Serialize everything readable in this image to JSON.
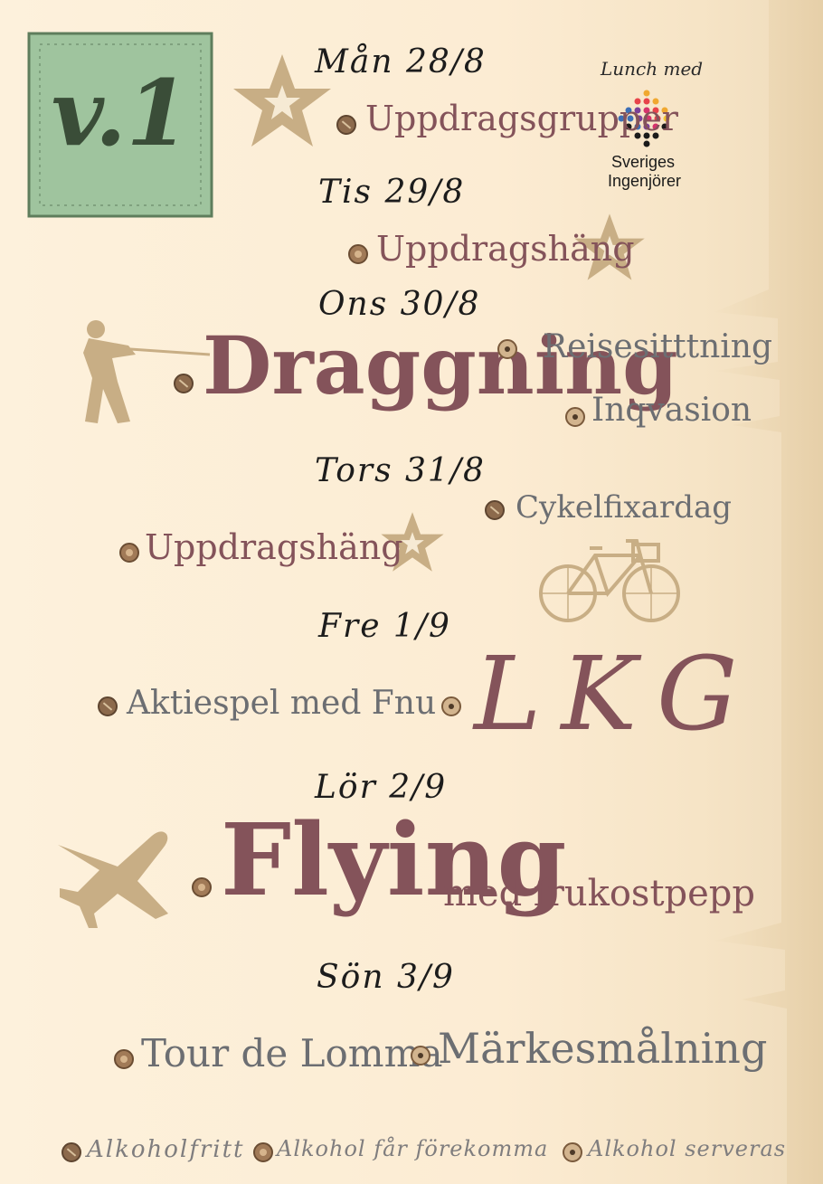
{
  "badge": {
    "text": "v.1"
  },
  "lunch": {
    "heading": "Lunch med",
    "org_line1": "Sveriges",
    "org_line2": "Ingenjörer"
  },
  "days": [
    {
      "label": "Mån 28/8",
      "events": [
        {
          "name": "Uppdragsgrupper",
          "alcohol": "free"
        }
      ]
    },
    {
      "label": "Tis 29/8",
      "events": [
        {
          "name": "Uppdragshäng",
          "alcohol": "may"
        }
      ]
    },
    {
      "label": "Ons 30/8",
      "events": [
        {
          "name": "Draggning",
          "alcohol": "free"
        },
        {
          "name": "Reisesitttning",
          "alcohol": "serve"
        },
        {
          "name": "Inqvasion",
          "alcohol": "serve"
        }
      ]
    },
    {
      "label": "Tors 31/8",
      "events": [
        {
          "name": "Uppdragshäng",
          "alcohol": "may"
        },
        {
          "name": "Cykelfixardag",
          "alcohol": "free"
        }
      ]
    },
    {
      "label": "Fre 1/9",
      "events": [
        {
          "name": "Aktiespel med Fnu",
          "alcohol": "free"
        },
        {
          "name": "LKG",
          "alcohol": "serve"
        }
      ]
    },
    {
      "label": "Lör 2/9",
      "events": [
        {
          "name": "Flying",
          "suffix": "med frukostpepp",
          "alcohol": "may"
        }
      ]
    },
    {
      "label": "Sön 3/9",
      "events": [
        {
          "name": "Tour de Lomma",
          "alcohol": "may"
        },
        {
          "name": "Märkesmålning",
          "alcohol": "serve"
        }
      ]
    }
  ],
  "legend": {
    "free": "Alkoholfritt",
    "may": "Alkohol får förekomma",
    "serve": "Alkohol serveras"
  },
  "colors": {
    "maroon": "#84535a",
    "grey": "#6c6e72",
    "tan": "#c8ae85",
    "badge_green": "#9fc49e"
  },
  "icons": [
    "star-icon",
    "tug-of-war-person-icon",
    "bicycle-icon",
    "airplane-icon",
    "sveriges-ingenjorer-logo-icon"
  ]
}
